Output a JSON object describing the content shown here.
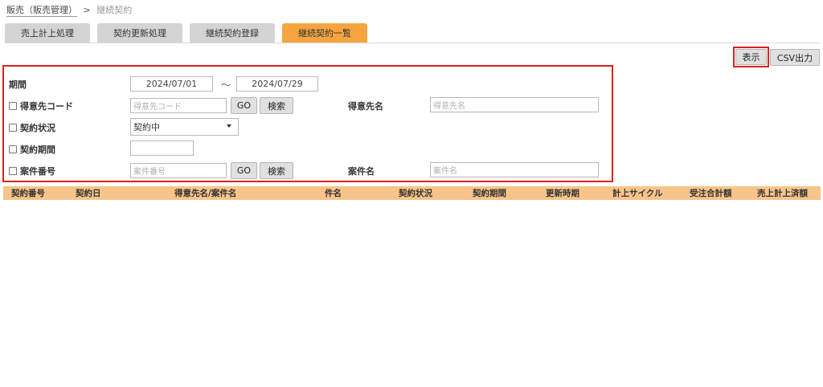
{
  "breadcrumb": {
    "parent": "販売（販売管理）",
    "separator": ">",
    "current": "継続契約"
  },
  "tabs": [
    {
      "label": "売上計上処理",
      "active": false
    },
    {
      "label": "契約更新処理",
      "active": false
    },
    {
      "label": "継続契約登録",
      "active": false
    },
    {
      "label": "継続契約一覧",
      "active": true
    }
  ],
  "actions": {
    "display_label": "表示",
    "csv_label": "CSV出力"
  },
  "search": {
    "period": {
      "label": "期間",
      "from": "2024/07/01",
      "tilde": "～",
      "to": "2024/07/29"
    },
    "customer_code": {
      "label": "得意先コード",
      "placeholder": "得意先コード",
      "go_label": "GO",
      "search_label": "検索"
    },
    "customer_name": {
      "label": "得意先名",
      "placeholder": "得意先名"
    },
    "contract_status": {
      "label": "契約状況",
      "selected": "契約中"
    },
    "contract_period": {
      "label": "契約期間",
      "value": ""
    },
    "project_number": {
      "label": "案件番号",
      "placeholder": "案件番号",
      "go_label": "GO",
      "search_label": "検索"
    },
    "project_name": {
      "label": "案件名",
      "placeholder": "案件名"
    }
  },
  "table": {
    "columns": [
      "契約番号",
      "契約日",
      "得意先名/案件名",
      "件名",
      "契約状況",
      "契約期間",
      "更新時期",
      "計上サイクル",
      "受注合計額",
      "売上計上済額"
    ]
  },
  "colors": {
    "active_tab": "#f5a540",
    "inactive_tab": "#d4d4d4",
    "table_header": "#f8c48a",
    "highlight_border": "#e02020"
  }
}
